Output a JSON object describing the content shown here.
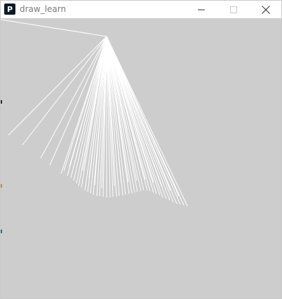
{
  "window": {
    "title": "draw_learn",
    "app_icon_letter": "P"
  },
  "titlebar": {
    "minimize_icon": "minimize-icon",
    "maximize_icon": "maximize-icon",
    "close_icon": "close-icon"
  },
  "canvas": {
    "background_color": "#cdcdcd",
    "stroke_color": "#ffffff"
  },
  "colors": {
    "titlebar_bg": "#ffffff",
    "title_text": "#7a7a7a",
    "app_icon_bg": "#0d1b26"
  }
}
